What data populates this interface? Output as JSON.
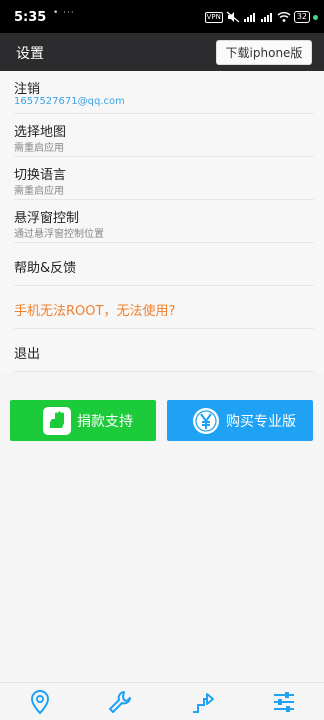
{
  "status_bar": {
    "time": "5:35",
    "dots": "• ···",
    "vpn": "VPN",
    "battery": "32"
  },
  "header": {
    "title": "设置",
    "download_label": "下载iphone版"
  },
  "settings": [
    {
      "title": "注销",
      "subtitle": "1657527671@qq.com"
    },
    {
      "title": "选择地图",
      "subtitle": "需重启应用"
    },
    {
      "title": "切换语言",
      "subtitle": "需重启应用"
    },
    {
      "title": "悬浮窗控制",
      "subtitle": "通过悬浮窗控制位置"
    },
    {
      "title": "帮助&反馈"
    },
    {
      "title": "手机无法ROOT，无法使用?"
    },
    {
      "title": "退出"
    }
  ],
  "actions": {
    "donate_label": "捐款支持",
    "pro_label": "购买专业版"
  },
  "bottom_nav": [
    {
      "icon": "location-pin-icon"
    },
    {
      "icon": "wrench-icon"
    },
    {
      "icon": "route-arrow-icon"
    },
    {
      "icon": "sliders-icon"
    }
  ],
  "colors": {
    "header_bg": "#2c2c2e",
    "accent_blue": "#1fa2f3",
    "accent_green": "#1ccb3a",
    "warning_orange": "#f0812e",
    "link_blue": "#3ba3e8"
  }
}
